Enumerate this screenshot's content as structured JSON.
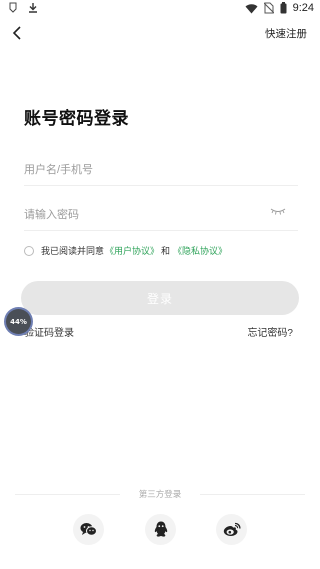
{
  "status_bar": {
    "time": "9:24",
    "left_icons": [
      "notification-icon",
      "download-icon"
    ],
    "right_icons": [
      "wifi-icon",
      "no-sim-icon",
      "battery-icon"
    ]
  },
  "nav": {
    "back_icon": "back-chevron-icon",
    "register_label": "快速注册"
  },
  "page_title": "账号密码登录",
  "form": {
    "username_placeholder": "用户名/手机号",
    "password_placeholder": "请输入密码",
    "password_visibility_icon": "eye-closed-icon"
  },
  "agreement": {
    "prefix": "我已阅读并同意",
    "user_agreement": "《用户协议》",
    "conjunction": "和",
    "privacy_policy": "《隐私协议》"
  },
  "login_button_label": "登录",
  "code_login_label": "验证码登录",
  "forgot_password_label": "忘记密码?",
  "progress_bubble": {
    "label": "44%",
    "value": 0.44
  },
  "third_party": {
    "label": "第三方登录",
    "options": [
      "wechat-icon",
      "qq-icon",
      "weibo-icon"
    ]
  },
  "colors": {
    "link": "#2fa35a",
    "button_disabled": "#e6e6e6",
    "placeholder": "#9b9b9b"
  }
}
